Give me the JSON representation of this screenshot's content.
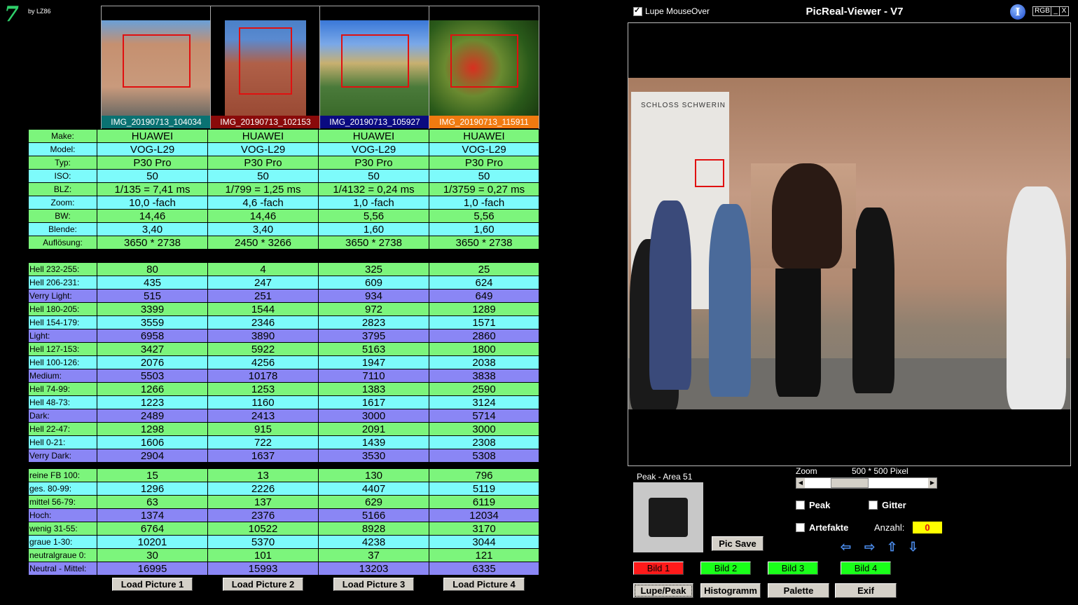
{
  "logo": {
    "glyph": "7",
    "by": "by LZ86"
  },
  "thumbnails": [
    {
      "label": "IMG_20190713_104034",
      "label_bg": "#0a7272"
    },
    {
      "label": "IMG_20190713_102153",
      "label_bg": "#8a0a0a"
    },
    {
      "label": "IMG_20190713_105927",
      "label_bg": "#0a0a80"
    },
    {
      "label": "IMG_20190713_115911",
      "label_bg": "#f07a10"
    }
  ],
  "table": {
    "meta_rows": [
      {
        "label": "Make:",
        "bg": "g",
        "values": [
          "HUAWEI",
          "HUAWEI",
          "HUAWEI",
          "HUAWEI"
        ]
      },
      {
        "label": "Model:",
        "bg": "c",
        "values": [
          "VOG-L29",
          "VOG-L29",
          "VOG-L29",
          "VOG-L29"
        ]
      },
      {
        "label": "Typ:",
        "bg": "g",
        "values": [
          "P30 Pro",
          "P30 Pro",
          "P30 Pro",
          "P30 Pro"
        ]
      },
      {
        "label": "ISO:",
        "bg": "c",
        "values": [
          "50",
          "50",
          "50",
          "50"
        ]
      },
      {
        "label": "BLZ:",
        "bg": "g",
        "values": [
          "1/135 = 7,41 ms",
          "1/799 = 1,25 ms",
          "1/4132 = 0,24 ms",
          "1/3759 = 0,27 ms"
        ]
      },
      {
        "label": "Zoom:",
        "bg": "c",
        "values": [
          "10,0 -fach",
          "4,6 -fach",
          "1,0 -fach",
          "1,0 -fach"
        ]
      },
      {
        "label": "BW:",
        "bg": "g",
        "values": [
          "14,46",
          "14,46",
          "5,56",
          "5,56"
        ]
      },
      {
        "label": "Blende:",
        "bg": "c",
        "values": [
          "3,40",
          "3,40",
          "1,60",
          "1,60"
        ]
      },
      {
        "label": "Auflösung:",
        "bg": "g",
        "values": [
          "3650 * 2738",
          "2450 * 3266",
          "3650 * 2738",
          "3650 * 2738"
        ]
      }
    ],
    "hell_rows": [
      {
        "label": "Hell 232-255:",
        "bg": "g",
        "values": [
          "80",
          "4",
          "325",
          "25"
        ]
      },
      {
        "label": "Hell 206-231:",
        "bg": "c",
        "values": [
          "435",
          "247",
          "609",
          "624"
        ]
      },
      {
        "label": "Verry Light:",
        "bg": "p",
        "values": [
          "515",
          "251",
          "934",
          "649"
        ]
      },
      {
        "label": "Hell 180-205:",
        "bg": "g",
        "values": [
          "3399",
          "1544",
          "972",
          "1289"
        ]
      },
      {
        "label": "Hell 154-179:",
        "bg": "c",
        "values": [
          "3559",
          "2346",
          "2823",
          "1571"
        ]
      },
      {
        "label": "Light:",
        "bg": "p",
        "values": [
          "6958",
          "3890",
          "3795",
          "2860"
        ]
      },
      {
        "label": "Hell 127-153:",
        "bg": "g",
        "values": [
          "3427",
          "5922",
          "5163",
          "1800"
        ]
      },
      {
        "label": "Hell 100-126:",
        "bg": "c",
        "values": [
          "2076",
          "4256",
          "1947",
          "2038"
        ]
      },
      {
        "label": "Medium:",
        "bg": "p",
        "values": [
          "5503",
          "10178",
          "7110",
          "3838"
        ]
      },
      {
        "label": "Hell 74-99:",
        "bg": "g",
        "values": [
          "1266",
          "1253",
          "1383",
          "2590"
        ]
      },
      {
        "label": "Hell 48-73:",
        "bg": "c",
        "values": [
          "1223",
          "1160",
          "1617",
          "3124"
        ]
      },
      {
        "label": "Dark:",
        "bg": "p",
        "values": [
          "2489",
          "2413",
          "3000",
          "5714"
        ]
      },
      {
        "label": "Hell 22-47:",
        "bg": "g",
        "values": [
          "1298",
          "915",
          "2091",
          "3000"
        ]
      },
      {
        "label": "Hell 0-21:",
        "bg": "c",
        "values": [
          "1606",
          "722",
          "1439",
          "2308"
        ]
      },
      {
        "label": "Verry Dark:",
        "bg": "p",
        "values": [
          "2904",
          "1637",
          "3530",
          "5308"
        ]
      }
    ],
    "color_rows": [
      {
        "label": "reine FB 100:",
        "bg": "g",
        "values": [
          "15",
          "13",
          "130",
          "796"
        ]
      },
      {
        "label": "ges. 80-99:",
        "bg": "c",
        "values": [
          "1296",
          "2226",
          "4407",
          "5119"
        ]
      },
      {
        "label": "mittel 56-79:",
        "bg": "g",
        "values": [
          "63",
          "137",
          "629",
          "6119"
        ]
      },
      {
        "label": "Hoch:",
        "bg": "p",
        "values": [
          "1374",
          "2376",
          "5166",
          "12034"
        ]
      },
      {
        "label": "wenig 31-55:",
        "bg": "g",
        "values": [
          "6764",
          "10522",
          "8928",
          "3170"
        ]
      },
      {
        "label": "graue  1-30:",
        "bg": "c",
        "values": [
          "10201",
          "5370",
          "4238",
          "3044"
        ]
      },
      {
        "label": "neutralgraue 0:",
        "bg": "g",
        "values": [
          "30",
          "101",
          "37",
          "121"
        ]
      },
      {
        "label": "Neutral - Mittel:",
        "bg": "p",
        "values": [
          "16995",
          "15993",
          "13203",
          "6335"
        ]
      }
    ],
    "load_buttons": [
      "Load Picture 1",
      "Load Picture 2",
      "Load Picture 3",
      "Load Picture 4"
    ]
  },
  "header": {
    "lupe_label": "Lupe MouseOver",
    "title": "PicReal-Viewer - V7",
    "info_glyph": "I",
    "rgb": "RGB",
    "min": "_",
    "close": "X"
  },
  "viewer": {
    "sign_text": "SCHLOSS SCHWERIN"
  },
  "peak": {
    "title": "Peak - Area 51",
    "pic_save": "Pic Save"
  },
  "zoom": {
    "label": "Zoom",
    "value": "500 * 500 Pixel",
    "level": 0.3
  },
  "options": {
    "peak": "Peak",
    "gitter": "Gitter",
    "artefakte": "Artefakte",
    "anzahl_label": "Anzahl:",
    "anzahl_value": "0"
  },
  "arrows": [
    "⇦",
    "⇨",
    "⇧",
    "⇩"
  ],
  "bild_buttons": [
    {
      "label": "Bild 1",
      "color": "#ff1a1a"
    },
    {
      "label": "Bild 2",
      "color": "#1aff1a"
    },
    {
      "label": "Bild 3",
      "color": "#1aff1a"
    },
    {
      "label": "Bild 4",
      "color": "#1aff1a"
    }
  ],
  "bottom_buttons": [
    "Lupe/Peak",
    "Histogramm",
    "Palette",
    "Exif"
  ]
}
